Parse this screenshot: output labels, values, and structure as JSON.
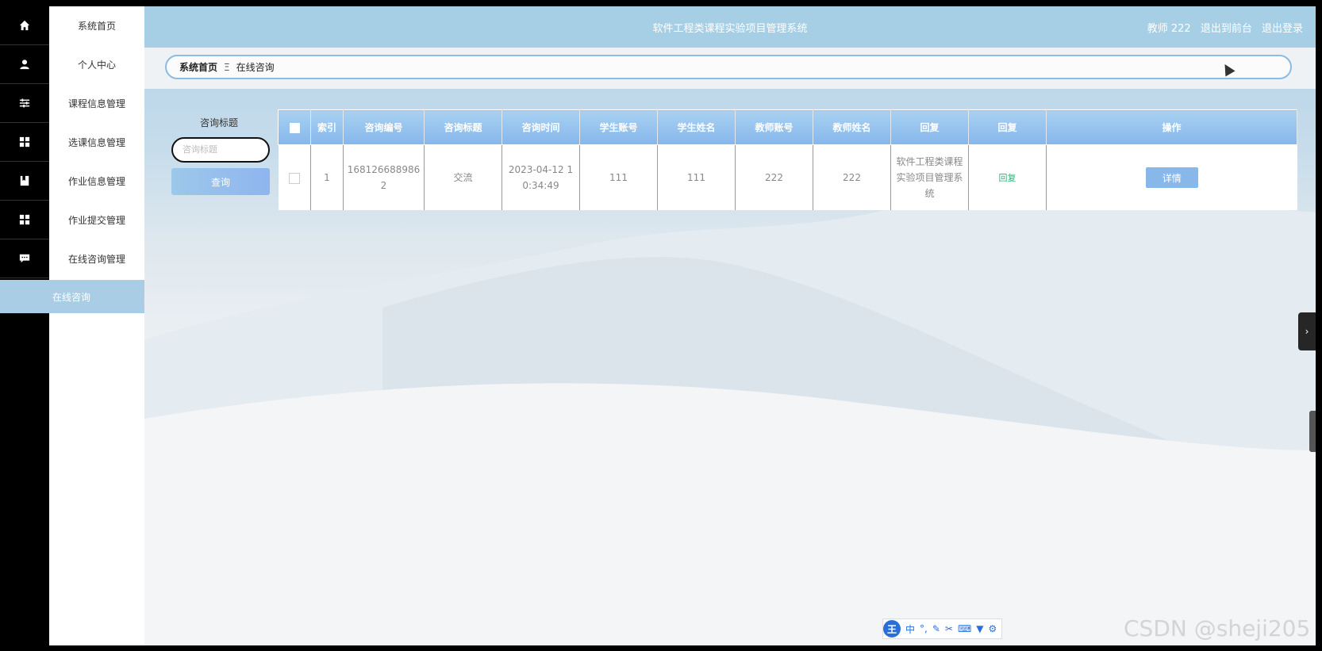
{
  "header": {
    "title": "软件工程类课程实验项目管理系统",
    "user": "教师 222",
    "to_front": "退出到前台",
    "logout": "退出登录"
  },
  "sidebar": {
    "items": [
      {
        "label": "系统首页",
        "icon": "home-icon"
      },
      {
        "label": "个人中心",
        "icon": "user-icon"
      },
      {
        "label": "课程信息管理",
        "icon": "sliders-icon"
      },
      {
        "label": "选课信息管理",
        "icon": "grid-icon"
      },
      {
        "label": "作业信息管理",
        "icon": "book-icon"
      },
      {
        "label": "作业提交管理",
        "icon": "grid-icon"
      },
      {
        "label": "在线咨询管理",
        "icon": "chat-icon"
      }
    ],
    "active_sub": "在线咨询"
  },
  "breadcrumb": {
    "home": "系统首页",
    "separator": "Ξ",
    "current": "在线咨询"
  },
  "search": {
    "label": "咨询标题",
    "placeholder": "咨询标题",
    "value": "",
    "button": "查询"
  },
  "table": {
    "headers": [
      "索引",
      "咨询编号",
      "咨询标题",
      "咨询时间",
      "学生账号",
      "学生姓名",
      "教师账号",
      "教师姓名",
      "回复",
      "回复",
      "操作"
    ],
    "rows": [
      {
        "index": "1",
        "consult_no": "1681266889862",
        "title": "交流",
        "time": "2023-04-12 10:34:49",
        "student_account": "111",
        "student_name": "111",
        "teacher_account": "222",
        "teacher_name": "222",
        "reply": "软件工程类课程实验项目管理系统",
        "reply_link": "回复",
        "action": "详情"
      }
    ]
  },
  "ime": {
    "logo": "王",
    "mode": "中"
  },
  "watermark": "CSDN @sheji205",
  "colors": {
    "topbar": "#a6cfe6",
    "accent": "#86b7ec",
    "reply_link": "#2bb573"
  }
}
